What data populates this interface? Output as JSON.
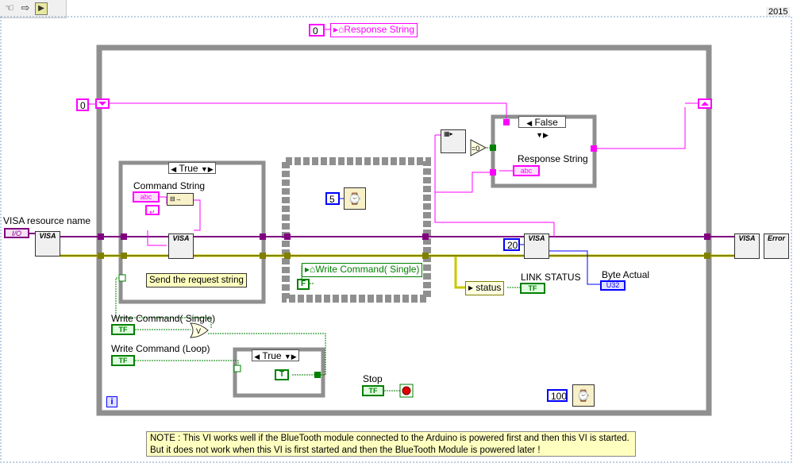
{
  "toolbar": {
    "icons": [
      "hand-icon",
      "step-arrow-icon",
      "highlight-bulb-icon"
    ],
    "version": "2015"
  },
  "labels": {
    "visa_resource_name": "VISA resource name",
    "command_string": "Command String",
    "write_command_single": "Write Command( Single)",
    "write_command_loop": "Write Command (Loop)",
    "stop": "Stop",
    "link_status": "LINK STATUS",
    "byte_actual": "Byte Actual",
    "response_string": "Response String",
    "send_request": "Send the request string",
    "iteration": "i"
  },
  "constants": {
    "init_zero": "0",
    "loop_zero": "0",
    "wait_ms": "5",
    "bytes_to_read": "20",
    "loop_wait": "100",
    "false_const": "F",
    "true_const": "T",
    "status": "status",
    "visa_type": "I/O",
    "abc": "abc",
    "tf": "TF",
    "u32": "U32"
  },
  "case_selectors": {
    "case1": "True",
    "case2": "True",
    "case3": "False"
  },
  "local_variables": {
    "response_string_top": "Response String",
    "write_command_local": "Write Command( Single)"
  },
  "nodes": {
    "visa_open": "VISA",
    "visa_write": "VISA",
    "visa_read": "VISA",
    "visa_close": "VISA",
    "error_handler": "Error",
    "equal_zero": "=0"
  },
  "note": {
    "line1": "NOTE :  This VI works well if the BlueTooth module connected to the Arduino is powered first and then this VI is started.",
    "line2": "But it does not work when this VI is first started and then the BlueTooth Module is powered later !"
  },
  "colors": {
    "visa_wire": "#800080",
    "error_wire": "#c8c800",
    "string_wire": "#ff00ff",
    "bool_wire": "#008000",
    "numeric_wire": "#0000ff",
    "while_loop": "#808080"
  }
}
